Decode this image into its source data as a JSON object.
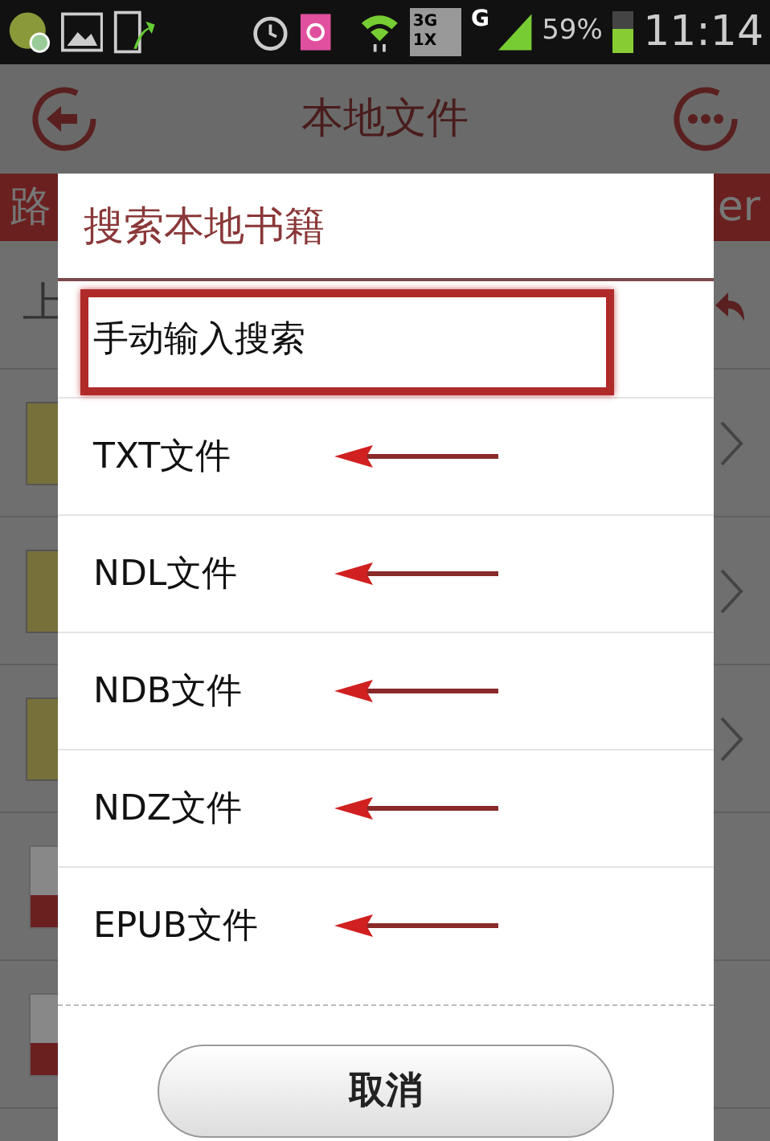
{
  "status_bar": {
    "network_top": "3G",
    "network_bottom": "1X",
    "data_type": "G",
    "battery": "59%",
    "time": "11:14"
  },
  "title_bar": {
    "title": "本地文件"
  },
  "path_bar": {
    "left": "路",
    "right": "er"
  },
  "up_row": {
    "label": "上"
  },
  "background_rows": [
    {
      "kind": "folder"
    },
    {
      "kind": "folder"
    },
    {
      "kind": "folder"
    },
    {
      "kind": "file"
    },
    {
      "kind": "file"
    }
  ],
  "dialog": {
    "title": "搜索本地书籍",
    "items": [
      {
        "label": "手动输入搜索",
        "kind": "boxed"
      },
      {
        "label": "TXT文件",
        "kind": "arrowed"
      },
      {
        "label": "NDL文件",
        "kind": "arrowed"
      },
      {
        "label": "NDB文件",
        "kind": "arrowed"
      },
      {
        "label": "NDZ文件",
        "kind": "arrowed"
      },
      {
        "label": "EPUB文件",
        "kind": "arrowed"
      }
    ],
    "cancel": "取消"
  }
}
